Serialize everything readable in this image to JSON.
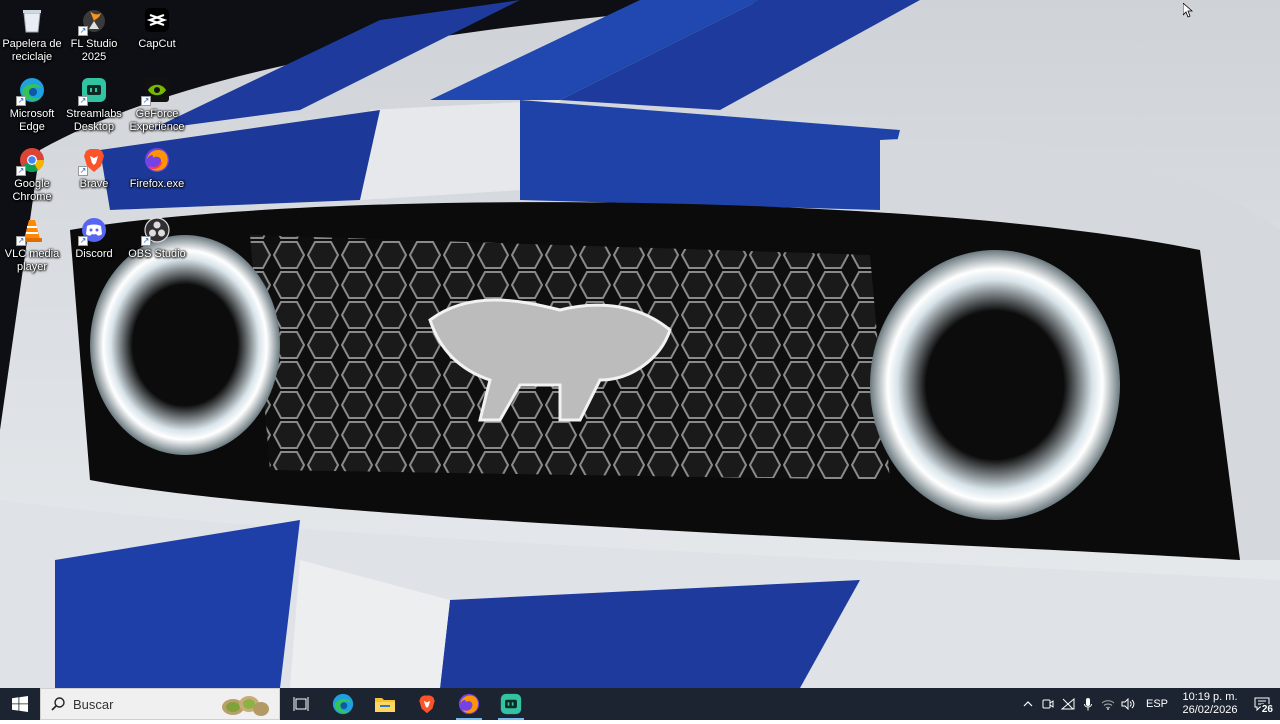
{
  "desktop": {
    "icons": [
      {
        "label": "Papelera de reciclaje",
        "icon": "recycle-bin-icon"
      },
      {
        "label": "FL Studio 2025",
        "icon": "fl-studio-icon"
      },
      {
        "label": "CapCut",
        "icon": "capcut-icon"
      },
      {
        "label": "Microsoft Edge",
        "icon": "edge-icon"
      },
      {
        "label": "Streamlabs Desktop",
        "icon": "streamlabs-icon"
      },
      {
        "label": "GeForce Experience",
        "icon": "geforce-icon"
      },
      {
        "label": "Google Chrome",
        "icon": "chrome-icon"
      },
      {
        "label": "Brave",
        "icon": "brave-icon"
      },
      {
        "label": "Firefox.exe",
        "icon": "firefox-icon"
      },
      {
        "label": "VLC media player",
        "icon": "vlc-icon"
      },
      {
        "label": "Discord",
        "icon": "discord-icon"
      },
      {
        "label": "OBS Studio",
        "icon": "obs-icon"
      }
    ]
  },
  "taskbar": {
    "search_placeholder": "Buscar",
    "pinned_apps": [
      "task-view-icon",
      "edge-icon",
      "file-explorer-icon",
      "brave-icon",
      "firefox-icon",
      "streamlabs-icon"
    ],
    "language": "ESP",
    "time": "10:19 p. m.",
    "date": "26/02/2026",
    "notification_count": "26",
    "colors": {
      "background": "#1b2430",
      "active_indicator": "#76b9ed"
    }
  }
}
